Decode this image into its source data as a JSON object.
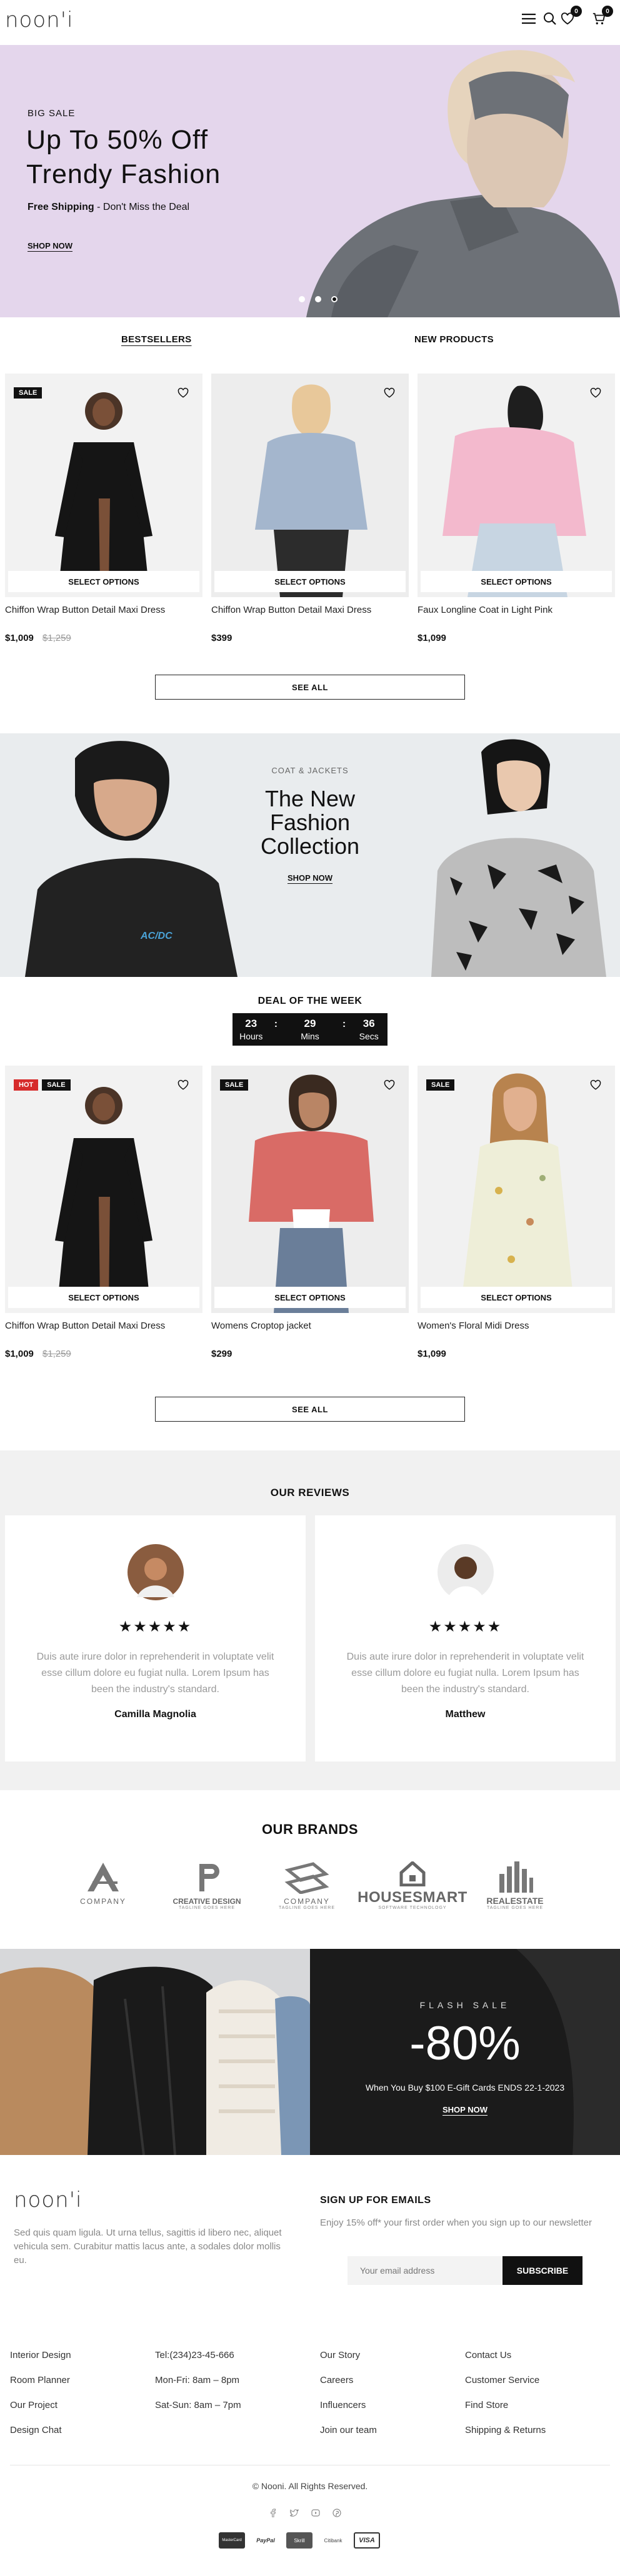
{
  "header": {
    "logo": "noon'i",
    "cart_count": "0",
    "wishlist_count": "0"
  },
  "hero": {
    "kicker": "BIG SALE",
    "title_line1": "Up To 50% Off",
    "title_line2": "Trendy Fashion",
    "shipping_bold": "Free Shipping",
    "shipping_rest": " - Don't Miss the Deal",
    "cta": "SHOP NOW",
    "slides": 3,
    "active_slide": 3
  },
  "tabs": {
    "bestsellers": "BESTSELLERS",
    "new_products": "NEW PRODUCTS"
  },
  "products1": [
    {
      "name": "Chiffon Wrap Button Detail Maxi Dress",
      "price": "$1,009",
      "old_price": "$1,259",
      "tags": [
        "SALE"
      ],
      "select": "SELECT OPTIONS"
    },
    {
      "name": "Chiffon Wrap Button Detail Maxi Dress",
      "price": "$399",
      "old_price": "",
      "tags": [],
      "select": "SELECT OPTIONS"
    },
    {
      "name": "Faux Longline Coat in Light Pink",
      "price": "$1,099",
      "old_price": "",
      "tags": [],
      "select": "SELECT OPTIONS"
    }
  ],
  "see_all": "SEE ALL",
  "collection": {
    "kicker": "COAT & JACKETS",
    "title_l1": "The New",
    "title_l2": "Fashion",
    "title_l3": "Collection",
    "cta": "SHOP NOW",
    "shirt_logo": "AC/DC"
  },
  "deal": {
    "title": "DEAL OF THE WEEK",
    "hours": "23",
    "hours_label": "Hours",
    "mins": "29",
    "mins_label": "Mins",
    "secs": "36",
    "secs_label": "Secs",
    "sep": ":"
  },
  "products2": [
    {
      "name": "Chiffon Wrap Button Detail Maxi Dress",
      "price": "$1,009",
      "old_price": "$1,259",
      "tags": [
        "HOT",
        "SALE"
      ],
      "select": "SELECT OPTIONS"
    },
    {
      "name": "Womens Croptop jacket",
      "price": "$299",
      "old_price": "",
      "tags": [
        "SALE"
      ],
      "select": "SELECT OPTIONS"
    },
    {
      "name": "Women's Floral Midi Dress",
      "price": "$1,099",
      "old_price": "",
      "tags": [
        "SALE"
      ],
      "select": "SELECT OPTIONS"
    }
  ],
  "reviews": {
    "title": "OUR REVIEWS",
    "items": [
      {
        "stars": "★★★★★",
        "text": "Duis aute irure dolor in reprehenderit in voluptate velit esse cillum dolore eu fugiat nulla. Lorem Ipsum has been the industry's standard.",
        "name": "Camilla Magnolia"
      },
      {
        "stars": "★★★★★",
        "text": "Duis aute irure dolor in reprehenderit in voluptate velit esse cillum dolore eu fugiat nulla. Lorem Ipsum has been the industry's standard.",
        "name": "Matthew"
      }
    ]
  },
  "brands": {
    "title": "OUR BRANDS",
    "items": [
      {
        "name": "COMPANY",
        "sub": ""
      },
      {
        "name": "CREATIVE DESIGN",
        "sub": "TAGLINE GOES HERE"
      },
      {
        "name": "COMPANY",
        "sub": "TAGLINE GOES HERE"
      },
      {
        "name": "HOUSESMART",
        "sub": "SOFTWARE TECHNOLOGY"
      },
      {
        "name": "REALESTATE",
        "sub": "TAGLINE GOES HERE"
      }
    ]
  },
  "flash": {
    "kicker": "FLASH SALE",
    "amount": "-80%",
    "desc": "When You Buy $100 E-Gift Cards ENDS 22-1-2023",
    "cta": "SHOP NOW"
  },
  "footer": {
    "logo": "noon'i",
    "about": "Sed quis quam ligula. Ut urna tellus, sagittis id libero nec, aliquet vehicula sem. Curabitur mattis lacus ante, a sodales dolor mollis eu.",
    "signup_title": "SIGN UP FOR EMAILS",
    "signup_text": "Enjoy 15% off* your first order when you sign up to our newsletter",
    "email_placeholder": "Your email address",
    "subscribe": "SUBSCRIBE",
    "col1": [
      "Interior Design",
      "Room Planner",
      "Our Project",
      "Design Chat"
    ],
    "col2": [
      "Tel:(234)23-45-666",
      "Mon-Fri: 8am – 8pm",
      "Sat-Sun: 8am – 7pm"
    ],
    "col3": [
      "Our Story",
      "Careers",
      "Influencers",
      "Join our team"
    ],
    "col4": [
      "Contact Us",
      "Customer Service",
      "Find Store",
      "Shipping & Returns"
    ],
    "copyright": "© Nooni. All Rights Reserved.",
    "social_icons": [
      "facebook-icon",
      "twitter-icon",
      "youtube-icon",
      "pinterest-icon"
    ],
    "payments": [
      "MasterCard",
      "PayPal",
      "Skrill",
      "Citibank",
      "VISA"
    ]
  }
}
